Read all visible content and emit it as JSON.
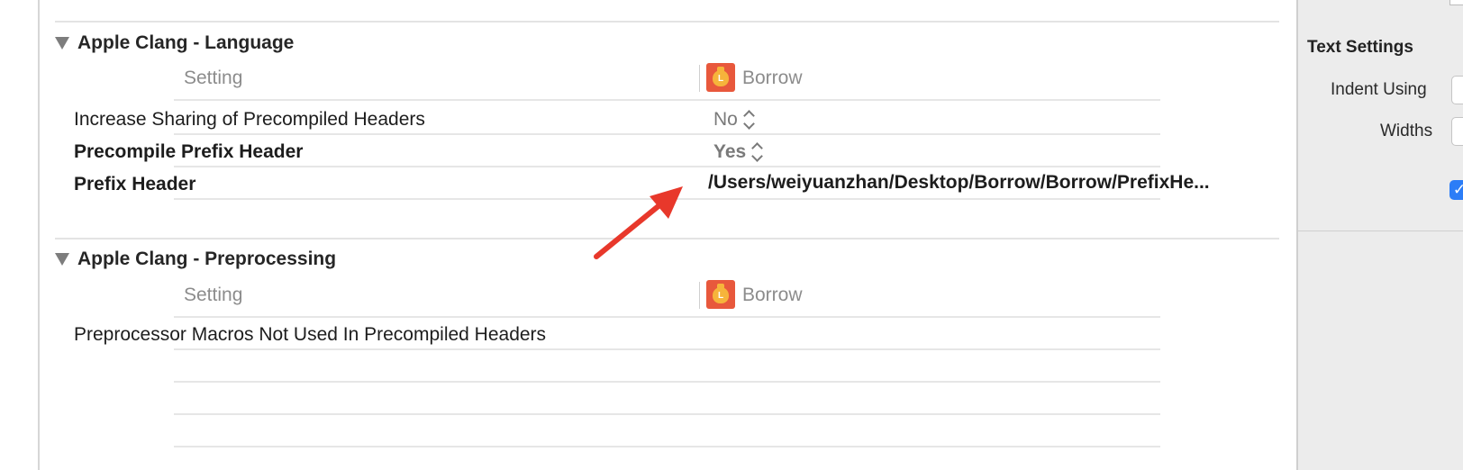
{
  "sections": [
    {
      "title": "Apple Clang - Language",
      "header": {
        "setting": "Setting",
        "target": "Borrow"
      },
      "rows": [
        {
          "setting": "Increase Sharing of Precompiled Headers",
          "value": "No"
        },
        {
          "setting": "Precompile Prefix Header",
          "value": "Yes"
        },
        {
          "setting": "Prefix Header",
          "value": "/Users/weiyuanzhan/Desktop/Borrow/Borrow/PrefixHe..."
        }
      ]
    },
    {
      "title": "Apple Clang - Preprocessing",
      "header": {
        "setting": "Setting",
        "target": "Borrow"
      },
      "rows": [
        {
          "setting": "Preprocessor Macros Not Used In Precompiled Headers",
          "value": ""
        }
      ]
    }
  ],
  "inspector": {
    "title": "Text Settings",
    "indent_label": "Indent Using",
    "widths_label": "Widths",
    "checkbox_checked": true
  },
  "annotation": {
    "color": "#e8382b",
    "icon": "red-arrow"
  },
  "colors": {
    "app_icon_bg": "#e8583c",
    "checkbox": "#2c7df7"
  }
}
